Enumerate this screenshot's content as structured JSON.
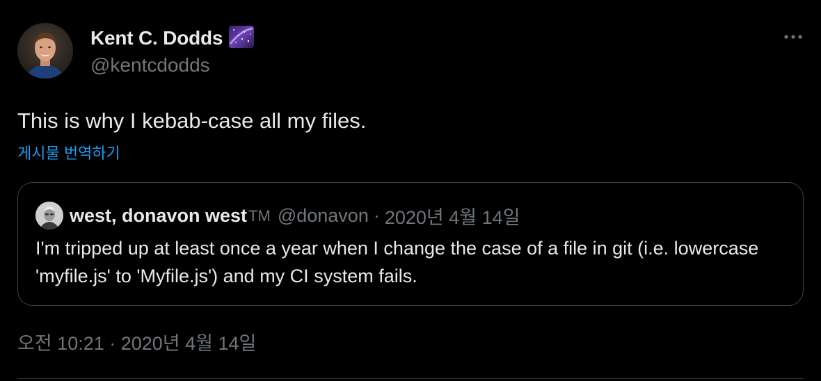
{
  "author": {
    "display_name": "Kent C. Dodds",
    "handle": "@kentcdodds",
    "avatar_icon": "profile-photo"
  },
  "tweet": {
    "text": "This is why I kebab-case all my files.",
    "translate_label": "게시물 번역하기",
    "timestamp": "오전 10:21 · 2020년 4월 14일"
  },
  "quoted_tweet": {
    "display_name": "west, donavon west",
    "name_suffix": "TM",
    "handle": "@donavon",
    "separator": "·",
    "date": "2020년 4월 14일",
    "text": "I'm tripped up at least once a year when I change the case of a file in git (i.e. lowercase 'myfile.js' to 'Myfile.js') and my CI system fails."
  },
  "colors": {
    "background": "#000000",
    "primary_text": "#e7e9ea",
    "secondary_text": "#71767b",
    "link": "#1d9bf0",
    "border": "#3e4144"
  }
}
